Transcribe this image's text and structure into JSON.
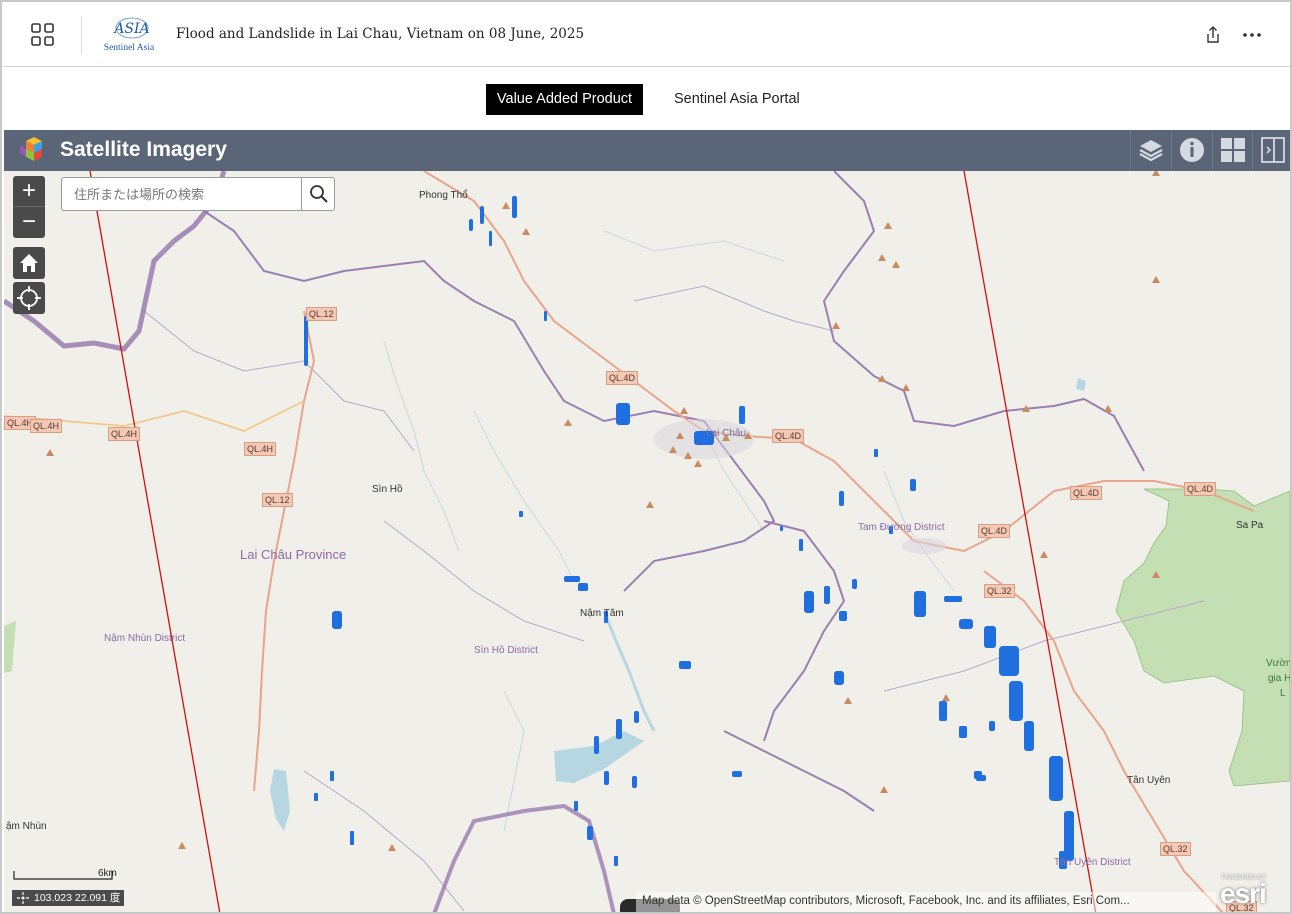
{
  "header": {
    "title": "Flood and Landslide in Lai Chau, Vietnam on 08 June, 2025",
    "logo_text": "Sentinel Asia",
    "logo_mark": "ASIA"
  },
  "tabs": [
    {
      "label": "Value Added Product",
      "active": true
    },
    {
      "label": "Sentinel Asia Portal",
      "active": false
    }
  ],
  "widget": {
    "title": "Satellite Imagery",
    "buttons": [
      "layers-icon",
      "info-icon",
      "grid-icon",
      "sidebar-icon"
    ]
  },
  "map": {
    "search_placeholder": "住所または場所の検索",
    "zoom_in": "+",
    "zoom_out": "−",
    "coordinates": "103.023 22.091 度",
    "scale_label": "6km",
    "attribution": "Map data © OpenStreetMap contributors, Microsoft, Facebook, Inc. and its affiliates, Esri Com...",
    "esri_powered": "POWERED BY",
    "esri_logo": "esri",
    "places": [
      {
        "name": "Phong Thổ"
      },
      {
        "name": "Lai Châu"
      },
      {
        "name": "Sìn Hồ"
      },
      {
        "name": "Nậm Tăm"
      },
      {
        "name": "Sa Pa"
      },
      {
        "name": "Tân Uyên"
      },
      {
        "name": "ậm Nhùn"
      },
      {
        "name": "Vườn"
      },
      {
        "name": "gia H"
      },
      {
        "name": "L"
      }
    ],
    "province": "Lai Châu Province",
    "districts": [
      "Nậm Nhùn District",
      "Sìn Hồ District",
      "Tam Đường District",
      "Tân Uyên District"
    ],
    "roads": [
      "QL.12",
      "QL.4D",
      "QL.4H",
      "QL.32"
    ],
    "colors": {
      "flood": "#1f6fe0",
      "footprint": "#d11010",
      "border": "#8c6ea8",
      "road": "#e9a48a",
      "forest": "#bfdcae",
      "water": "#a9cfe0",
      "widget_bar": "#5b6578"
    }
  }
}
